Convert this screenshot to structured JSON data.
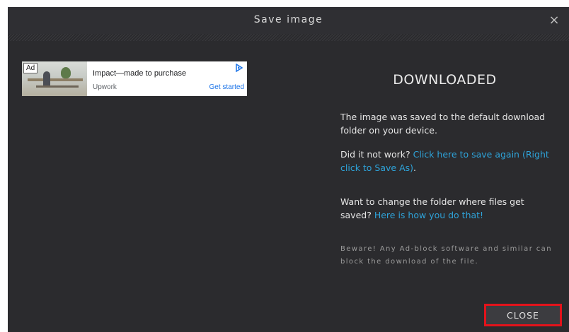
{
  "dialog": {
    "title": "Save image",
    "close_icon": "×"
  },
  "ad": {
    "badge": "Ad",
    "headline": "Impact—made to purchase",
    "advertiser": "Upwork",
    "cta": "Get started",
    "choices_icon": "adchoices-triangle-icon",
    "accent_color": "#1a73e8"
  },
  "content": {
    "heading": "DOWNLOADED",
    "paragraph1": "The image was saved to the default download folder on your device.",
    "paragraph2_text": "Did it not work?",
    "paragraph2_link1": "Click here to save again",
    "paragraph2_link2": "(Right click to Save As)",
    "paragraph2_end": ".",
    "paragraph3_text": "Want to change the folder where files get saved?",
    "paragraph3_link": "Here is how you do that!",
    "warning": "Beware! Any Ad-block software and similar can block the download of the file."
  },
  "footer": {
    "close_label": "CLOSE"
  },
  "colors": {
    "background": "#2b2b2e",
    "link": "#2ea3d9",
    "highlight": "#e3131b"
  }
}
